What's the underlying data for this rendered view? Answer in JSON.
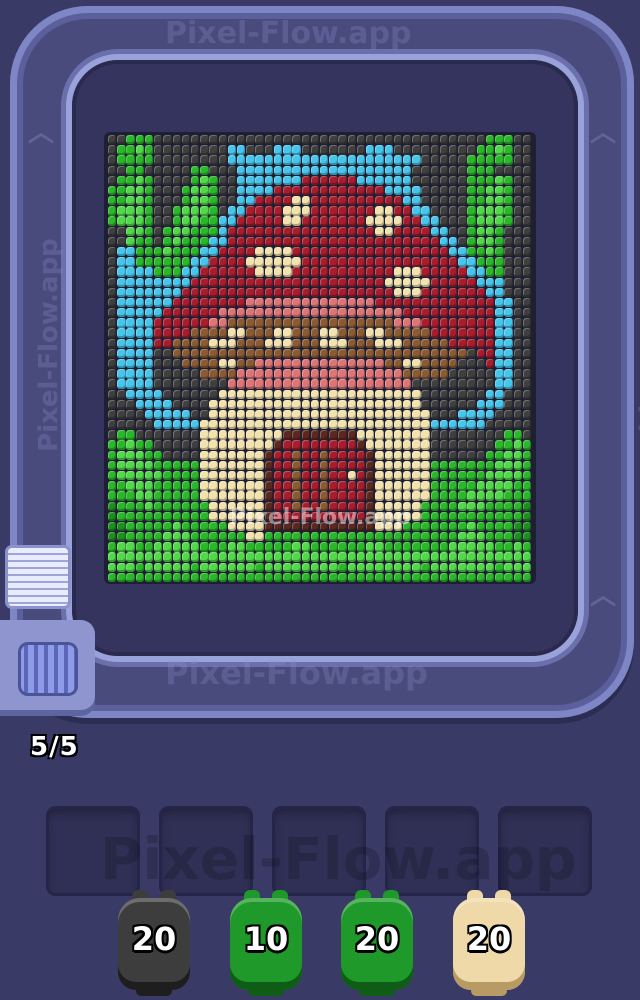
{
  "watermark": "Pixel-Flow.app",
  "progress": {
    "label": "5/5",
    "current": 5,
    "total": 5
  },
  "shooters": [
    {
      "count": "20",
      "color": "#3d3d3d",
      "dark": "#1e1e1e"
    },
    {
      "count": "10",
      "color": "#1f9a2a",
      "dark": "#0f5c16"
    },
    {
      "count": "20",
      "color": "#1f9a2a",
      "dark": "#0f5c16"
    },
    {
      "count": "20",
      "color": "#efd9a8",
      "dark": "#b89a64"
    }
  ],
  "slots": [
    {
      "state": "empty"
    },
    {
      "state": "empty"
    },
    {
      "state": "empty"
    },
    {
      "state": "empty"
    },
    {
      "state": "empty"
    }
  ],
  "palette": {
    "K": "#3f3f3f",
    "G": "#2ab82a",
    "L": "#52d94a",
    "D": "#1d8f1f",
    "B": "#47c6ec",
    "R": "#a71d2d",
    "P": "#dd7476",
    "C": "#f2e2ae",
    "N": "#8a5a32",
    "W": "#5a2820"
  },
  "pixel_rows": [
    "KKGGGKKKKKKKKKKKKKKKKKKKKKKKKKKKKKKKKKKKKGGGKK",
    "KGGLGKKKKKKKKBBKKKBBBKKKKKKKBBBKKKKKKKKKGGLGKK",
    "KGGGGKKKKKKKKBBBBBBBBBBBBBBBBBBBBBKKKKKGGGGGKK",
    "KKGGKKKKKGGKKKBBBBBBBBBBBBBBBBBBBKKKKKKGGGKKKK",
    "KGGLGKKKKGLGKKBBBBBBBRRRRRRBBBBBBKKKKKKGGGLGKK",
    "GGLLGKKKGLLGKKBBBBRRRRRRRRRRRRBBBBKKKKKGGLLGKK",
    "GGLLGKKKGLLGKKBBRRRRCCRRRRRRRRRRBBKKKKKGGLLGKK",
    "GLLLGKKGLLLGKBBRRRRCCCRRRRRRRCCRRBBKKKKGLLLGKK",
    "GLLLGKKGLLGGBBRRRRRCCRRRRRRRCCCCRRBBKKKGLLLGKK",
    "KKLLGKGLLGGGBRRRRRRRRRRRRRRRRCCRRRRBBKKGLLGKKK",
    "KKLGGKGLGGGBBRRRRRRRRRRRRRRRRRRRRRRRBBKGLLGKKK",
    "KBBGGGLGGGBBRRRRCCCCRRRRRRRRRRRRRRRRRBBGGLGKKK",
    "KBBGGGGGGBBRRRRCCCCCCRRRRRRRRRRRRRRRRRBBGGGKKK",
    "KBBBBGGGBBRRRRRRCCCCRRRRRRRRRRRCCCRRRRRBBGGKKK",
    "KBBBBBBBBRRRRRRRRRRRRRRRRRRRRRCCCCCRRRRRBBBKKK",
    "KBBBBBBBRRRRRRRRRRRRRRRRRRRRRRRCCCRRRRRRRBBKKK",
    "KBBBBBBRRRRRRRRPPPPPPPPPPPPPPRRRRRRRRRRRRRBBKK",
    "KBBBBBRRRRRRPPPPPPPPPPPPPPPPPPPPRRRRRRRRRRBBKK",
    "KBBBBRRRRRRPPNNNNNNNNNNNNNNNNNNPPPRRRRRRRRBBKK",
    "KBBBBRRRRNNNNCCNNNCCNNNCCNNNCCNNNNNRRRRRRRBBKK",
    "KBBBBRRNNNNCCCNNNCCCNNNCCCNNNCCCNNNNNRRRRRBBKK",
    "KBBBBKKNNNNNNNNNNNNNNNNNNNNNNNNNNNNNNNNKRRBBKK",
    "KBBBBKKKNNNNCCNNPPPPPPPPPPPPPPNNCCNNNNKKKRBBKK",
    "KBBBBKKKKKNNNNPPPPPPPPPPPPPPPPPPNNNNNKKKKKBBKK",
    "KBBBBKKKKKKKKPPPPPPPPPPPPPPPPPPPPKKKKKKKKKBBKK",
    "KKBBBBKKKKKKCCCCCCCCCCCCCCCCCCCCCCKKKKKKKBBKKK",
    "KKKBBBBKKKKCCCCCCCCCCCCCCCCCCCCCCCKKKKKKBBBKKK",
    "KKKKBBBBBKKCCCCCCCCCCCCCCCCCCCCCCCCKKKBBBBKKKK",
    "KKKKKBBBBBCCCCCCCCCCCCCCCCCCCCCCCCCBBBBBBKKKKK",
    "KGGKKKKKKKCCCCCCCCCWWWWWWWWCCCCCCCCKKKKKKKKGGK",
    "GGLGGKKKKKCCCCCCCCWRRRRRRRRWCCCCCCCKKKKKKKGGLG",
    "GLLLGGKKKKCCCCCCCWRRNRRNRRRRWCCCCCCKKKKKKGGLLG",
    "GLLLLGGGGGCCCCCCCWRRNRRNRRRRWCCCCCCGGGGGGGLLLG",
    "GLLLLLGGGGCCCCCCCWRRNRRNRRCRWCCCCCCGGGGGGLLLLG",
    "GGLLLGGGGGCCCCCCCWRRNRRNRRRRWCCCCCCGGGGGLLLLGG",
    "GGGLLGGGGGCCCCCCCWRRNRRNRRRRWCCCCCCGGGGLLLLGGG",
    "DGGGLGGGGGGCCCCCCWRRNRRNRRRRWCCCCCGGGGLLLGGGGD",
    "DGGGGGGGGGGCCCCCCWRRRRRRRRRRWCCCCCGGGGGGGGGGGD",
    "DDGGGGGLGGGGGCCCCWWWWWWWWWWWWCCCGGGGGGGLGGGGDD",
    "DDGGGGLLLGGGGGGCCGGGGGGGGGGGGGGGGGGGGGLLLGGGDD",
    "GLLGGLLLLLGGGLLGGGGGLLGGGGGGLLGGGGGGGLLLLLGGLG",
    "LLLLLLLLLLLLLLLLLLLLLLLLLLLLLLLLLLLLLLLLLLLLLL",
    "LLLGLLLLLGLLLLLLGLLLLLLLLGLLLLLLLLGLLLLLLLGLLL",
    "GGGGGGGGGGGGGGGGGGGGGGGGGGGGGGGGGGGGGGGGGGGGGG"
  ]
}
